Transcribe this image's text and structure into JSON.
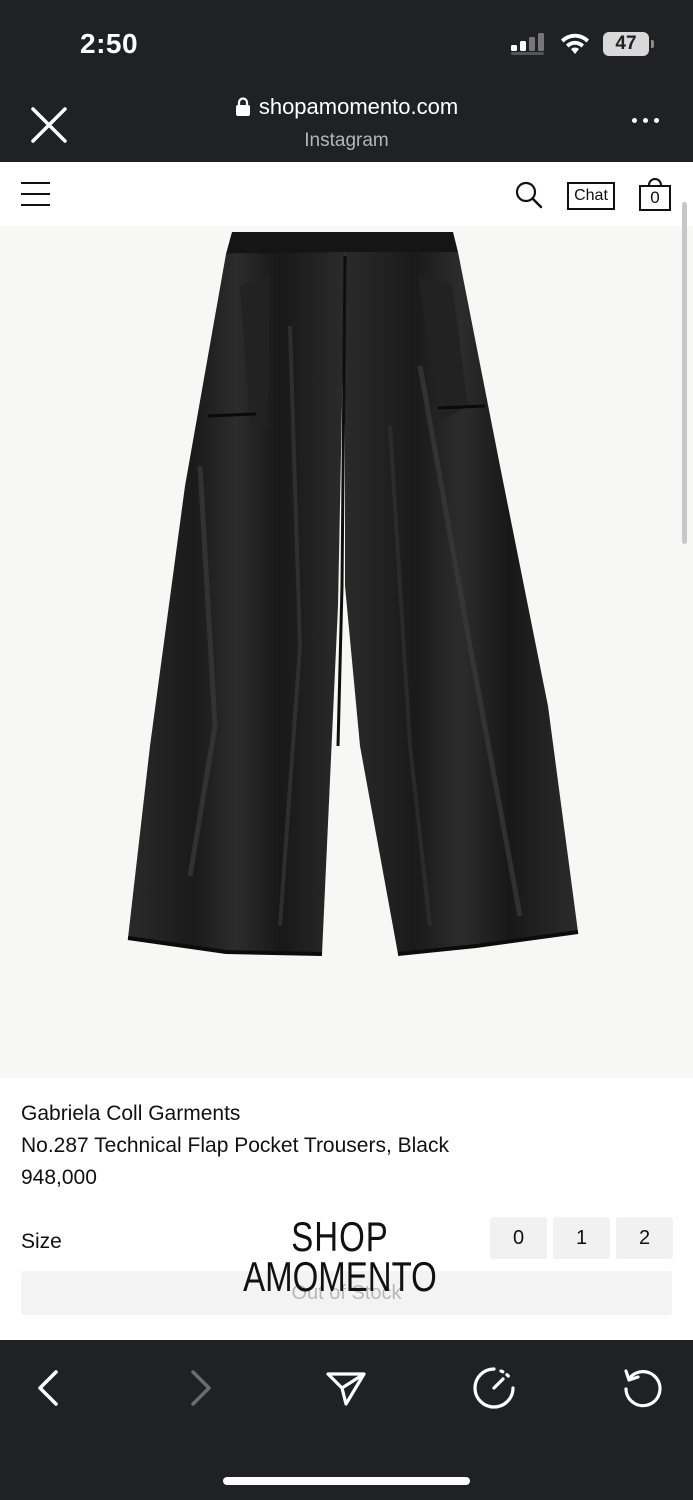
{
  "status_bar": {
    "time": "2:50",
    "battery": "47"
  },
  "browser": {
    "url": "shopamomento.com",
    "source": "Instagram",
    "icons": [
      "close-icon",
      "lock-icon",
      "more-icon"
    ]
  },
  "site_header": {
    "chat_label": "Chat",
    "cart_count": "0",
    "icons": [
      "menu-icon",
      "search-icon",
      "cart-icon"
    ]
  },
  "product": {
    "brand": "Gabriela Coll Garments",
    "name": "No.287 Technical Flap Pocket Trousers, Black",
    "price": "948,000",
    "size_label": "Size",
    "sizes": [
      "0",
      "1",
      "2"
    ],
    "availability": "Out of Stock"
  },
  "logo": {
    "line1": "SHOP",
    "line2": "AMOMENTO"
  },
  "toolbar": {
    "icons": [
      "back-icon",
      "forward-icon",
      "share-icon",
      "speed-icon",
      "reload-icon"
    ]
  },
  "colors": {
    "chrome": "#202124",
    "page_bg": "#ffffff",
    "image_bg": "#f7f7f5",
    "garment": "#1f1f1f"
  }
}
